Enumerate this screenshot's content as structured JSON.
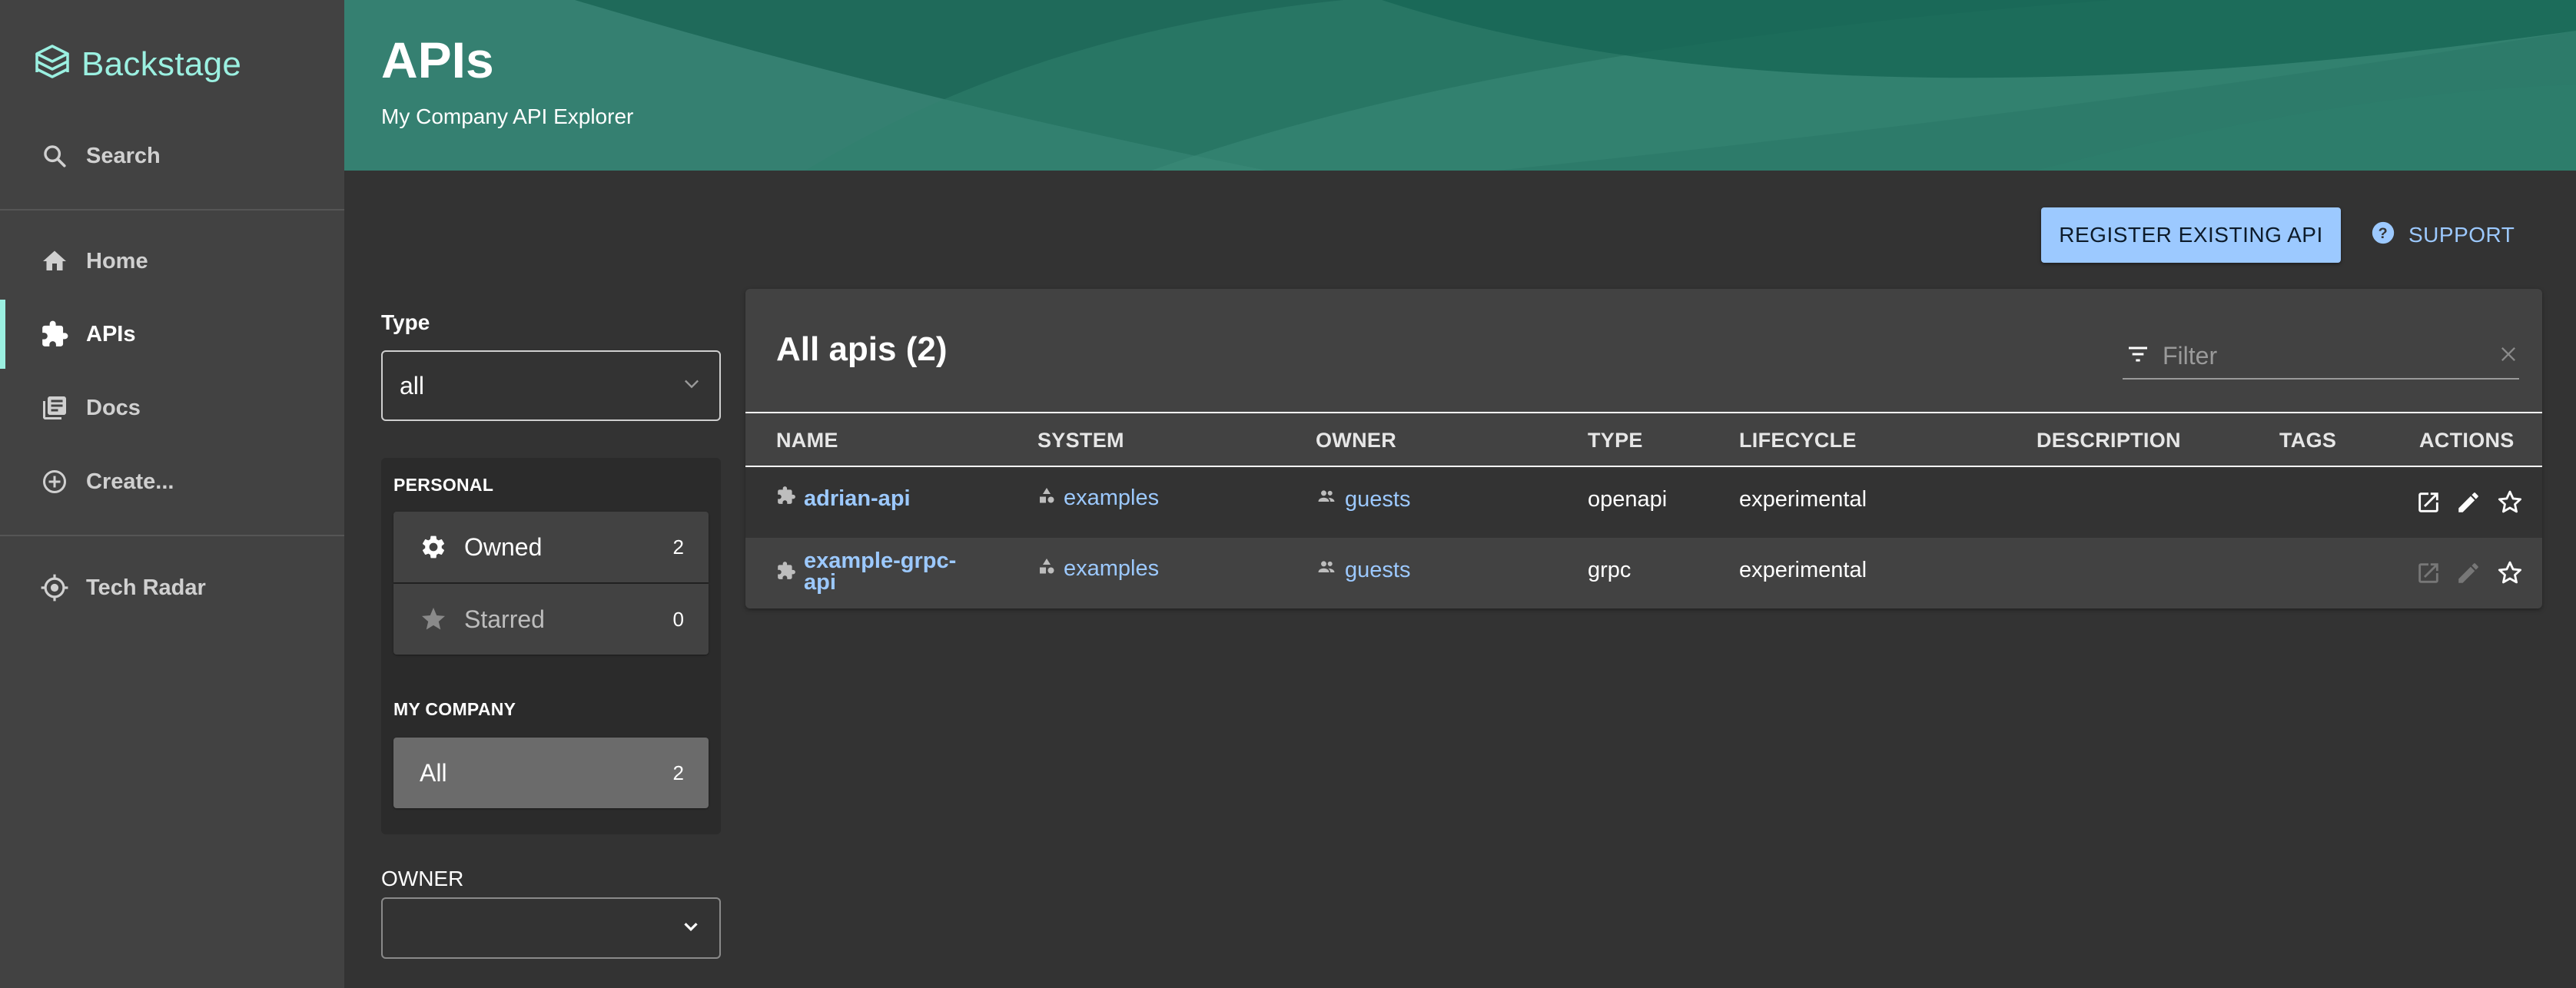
{
  "app": {
    "name": "Backstage"
  },
  "sidebar": {
    "search_label": "Search",
    "items": [
      {
        "label": "Home",
        "icon": "home-icon"
      },
      {
        "label": "APIs",
        "icon": "puzzle-icon",
        "active": true
      },
      {
        "label": "Docs",
        "icon": "library-icon"
      },
      {
        "label": "Create...",
        "icon": "add-circle-icon"
      },
      {
        "label": "Tech Radar",
        "icon": "radar-icon"
      }
    ]
  },
  "header": {
    "title": "APIs",
    "subtitle": "My Company API Explorer"
  },
  "actions": {
    "register_label": "REGISTER EXISTING API",
    "support_label": "SUPPORT"
  },
  "filters": {
    "type_label": "Type",
    "type_value": "all",
    "personal_label": "PERSONAL",
    "owned_label": "Owned",
    "owned_count": "2",
    "starred_label": "Starred",
    "starred_count": "0",
    "company_label": "MY COMPANY",
    "all_label": "All",
    "all_count": "2",
    "owner_label": "OWNER"
  },
  "table": {
    "title": "All apis (2)",
    "filter_placeholder": "Filter",
    "columns": [
      "NAME",
      "SYSTEM",
      "OWNER",
      "TYPE",
      "LIFECYCLE",
      "DESCRIPTION",
      "TAGS",
      "ACTIONS"
    ],
    "rows": [
      {
        "name": "adrian-api",
        "system": "examples",
        "owner": "guests",
        "type": "openapi",
        "lifecycle": "experimental",
        "description": "",
        "tags": ""
      },
      {
        "name_line1": "example-grpc-",
        "name_line2": "api",
        "system": "examples",
        "owner": "guests",
        "type": "grpc",
        "lifecycle": "experimental",
        "description": "",
        "tags": ""
      }
    ]
  },
  "colors": {
    "accent": "#9BF0E1",
    "link": "#9CC9FF",
    "header": "#1F6A5A",
    "background": "#333333",
    "sidebar": "#424242"
  }
}
